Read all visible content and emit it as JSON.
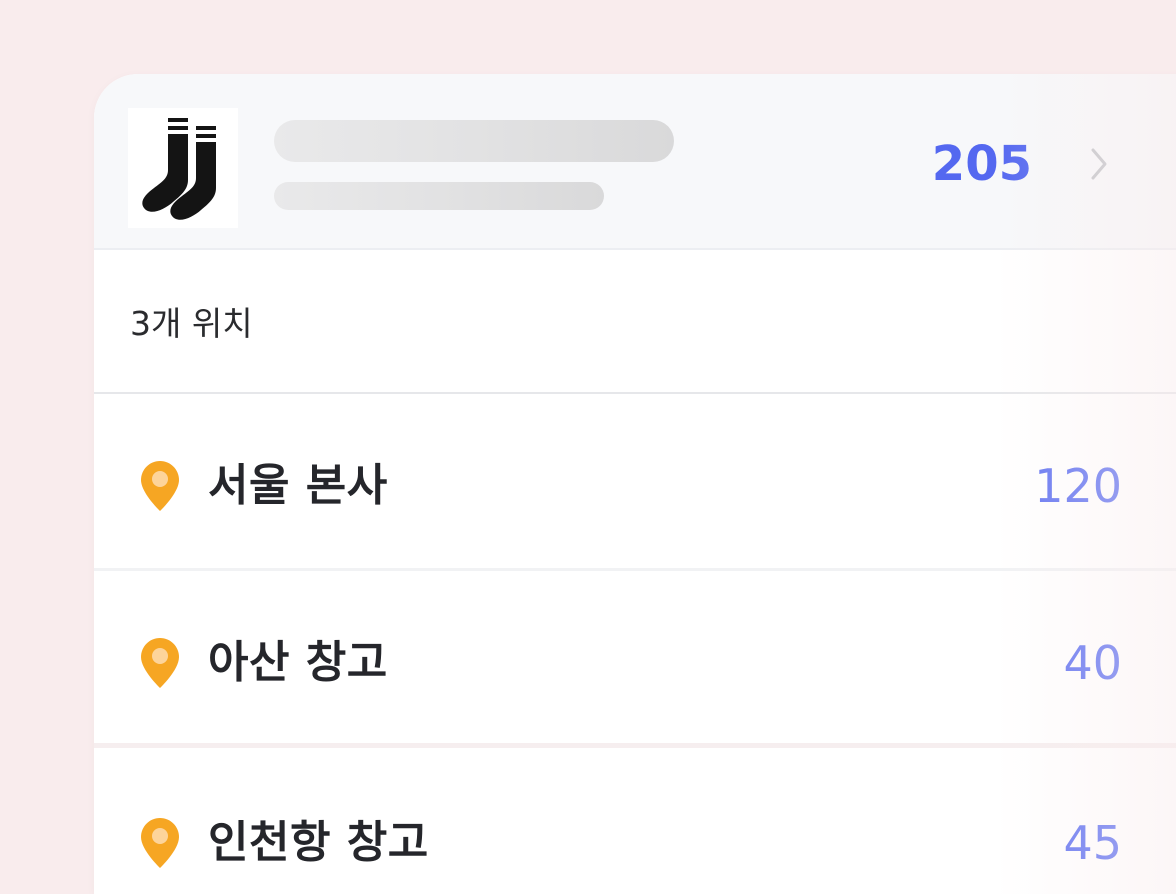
{
  "product": {
    "icon": "socks-icon",
    "total_quantity": "205"
  },
  "locations_summary": {
    "count_label": "3개 위치"
  },
  "locations": [
    {
      "icon": "location-pin-icon",
      "name": "서울 본사",
      "quantity": "120"
    },
    {
      "icon": "location-pin-icon",
      "name": "아산 창고",
      "quantity": "40"
    },
    {
      "icon": "location-pin-icon",
      "name": "인천항 창고",
      "quantity": "45"
    }
  ],
  "colors": {
    "background": "#f9eced",
    "accent_blue": "#5468f0",
    "quantity_blue": "#6677f2",
    "pin_orange": "#f6a623"
  }
}
